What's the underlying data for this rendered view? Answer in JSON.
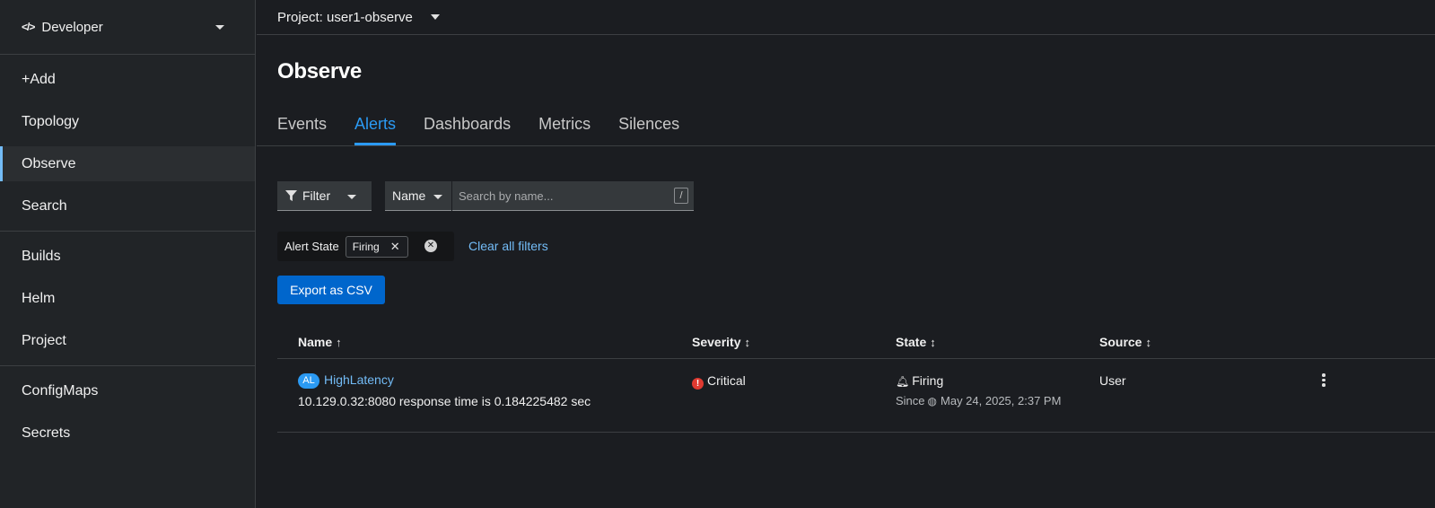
{
  "sidebar": {
    "perspective": "Developer",
    "groups": [
      [
        {
          "label": "+Add"
        },
        {
          "label": "Topology"
        },
        {
          "label": "Observe",
          "active": true
        },
        {
          "label": "Search"
        }
      ],
      [
        {
          "label": "Builds"
        },
        {
          "label": "Helm"
        },
        {
          "label": "Project"
        }
      ],
      [
        {
          "label": "ConfigMaps"
        },
        {
          "label": "Secrets"
        }
      ]
    ]
  },
  "project": {
    "label": "Project: user1-observe"
  },
  "page": {
    "title": "Observe"
  },
  "tabs": [
    {
      "label": "Events"
    },
    {
      "label": "Alerts",
      "active": true
    },
    {
      "label": "Dashboards"
    },
    {
      "label": "Metrics"
    },
    {
      "label": "Silences"
    }
  ],
  "toolbar": {
    "filter_label": "Filter",
    "name_select": "Name",
    "search_placeholder": "Search by name...",
    "search_shortcut": "/",
    "chip_group_label": "Alert State",
    "chip_value": "Firing",
    "clear_all": "Clear all filters",
    "export_label": "Export as CSV"
  },
  "table": {
    "headers": {
      "name": "Name",
      "severity": "Severity",
      "state": "State",
      "source": "Source"
    },
    "rows": [
      {
        "badge": "AL",
        "name": "HighLatency",
        "description": "10.129.0.32:8080 response time is 0.184225482 sec",
        "severity": "Critical",
        "state": "Firing",
        "since_label": "Since",
        "since_time": "May 24, 2025, 2:37 PM",
        "source": "User"
      }
    ]
  },
  "colors": {
    "accent": "#2b9af3",
    "link": "#73bcf7",
    "critical": "#e03a31",
    "primary_button": "#0066cc"
  },
  "icons": {
    "perspective": "code-icon",
    "filter": "funnel-icon",
    "severity": "exclamation-circle-icon",
    "state": "bell-icon",
    "since": "globe-icon",
    "row_actions": "kebab-icon"
  }
}
